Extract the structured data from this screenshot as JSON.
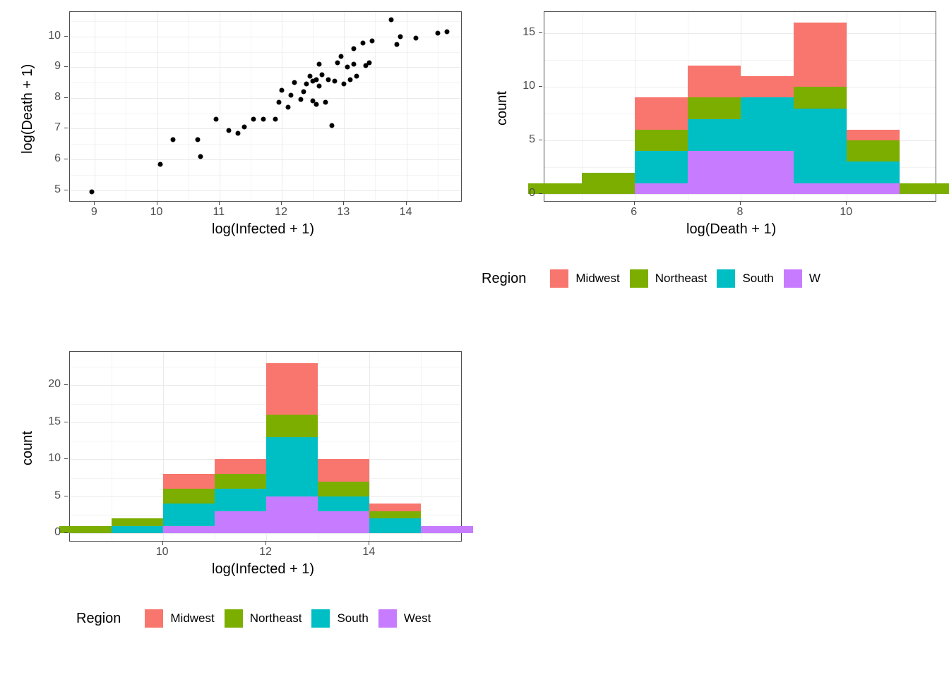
{
  "colors": {
    "Midwest": "#F8766D",
    "Northeast": "#7CAE00",
    "South": "#00BFC4",
    "West": "#C77CFF"
  },
  "legend": {
    "title": "Region",
    "items": [
      "Midwest",
      "Northeast",
      "South",
      "West"
    ],
    "label_midwest": "Midwest",
    "label_northeast": "Northeast",
    "label_south": "South",
    "label_west": "West",
    "label_west_clipped": "W"
  },
  "chart_data": [
    {
      "id": "scatter",
      "type": "scatter",
      "xlabel": "log(Infected + 1)",
      "ylabel": "log(Death + 1)",
      "x_ticks": [
        9,
        10,
        11,
        12,
        13,
        14
      ],
      "y_ticks": [
        5,
        6,
        7,
        8,
        9,
        10
      ],
      "xlim": [
        8.6,
        14.9
      ],
      "ylim": [
        4.6,
        10.8
      ],
      "points": [
        [
          8.95,
          4.95
        ],
        [
          10.05,
          5.85
        ],
        [
          10.25,
          6.65
        ],
        [
          10.65,
          6.65
        ],
        [
          10.7,
          6.1
        ],
        [
          10.95,
          7.3
        ],
        [
          11.15,
          6.95
        ],
        [
          11.3,
          6.85
        ],
        [
          11.4,
          7.05
        ],
        [
          11.55,
          7.3
        ],
        [
          11.7,
          7.3
        ],
        [
          11.9,
          7.3
        ],
        [
          11.95,
          7.85
        ],
        [
          12.0,
          8.25
        ],
        [
          12.1,
          7.7
        ],
        [
          12.15,
          8.1
        ],
        [
          12.2,
          8.5
        ],
        [
          12.3,
          7.95
        ],
        [
          12.35,
          8.2
        ],
        [
          12.4,
          8.45
        ],
        [
          12.45,
          8.7
        ],
        [
          12.5,
          7.9
        ],
        [
          12.5,
          8.55
        ],
        [
          12.55,
          8.6
        ],
        [
          12.55,
          7.8
        ],
        [
          12.6,
          8.4
        ],
        [
          12.6,
          9.1
        ],
        [
          12.65,
          8.75
        ],
        [
          12.7,
          7.85
        ],
        [
          12.75,
          8.6
        ],
        [
          12.8,
          7.1
        ],
        [
          12.85,
          8.55
        ],
        [
          12.9,
          9.15
        ],
        [
          12.95,
          9.35
        ],
        [
          13.0,
          8.45
        ],
        [
          13.05,
          9.0
        ],
        [
          13.1,
          8.6
        ],
        [
          13.15,
          9.1
        ],
        [
          13.15,
          9.6
        ],
        [
          13.2,
          8.7
        ],
        [
          13.3,
          9.8
        ],
        [
          13.35,
          9.05
        ],
        [
          13.4,
          9.15
        ],
        [
          13.45,
          9.85
        ],
        [
          13.75,
          10.55
        ],
        [
          13.85,
          9.75
        ],
        [
          13.9,
          10.0
        ],
        [
          14.15,
          9.95
        ],
        [
          14.5,
          10.1
        ],
        [
          14.65,
          10.15
        ]
      ]
    },
    {
      "id": "hist_death",
      "type": "bar",
      "xlabel": "log(Death + 1)",
      "ylabel": "count",
      "x_ticks": [
        6,
        8,
        10
      ],
      "y_ticks": [
        0,
        5,
        10,
        15
      ],
      "xlim": [
        4.3,
        11.7
      ],
      "ylim": [
        -0.8,
        17.0
      ],
      "bin_width": 1.0,
      "categories": [
        4.5,
        5.5,
        6.5,
        7.5,
        8.5,
        9.5,
        10.5,
        11.5
      ],
      "series": [
        {
          "name": "West",
          "color_key": "West",
          "values": [
            0,
            0,
            1,
            4,
            4,
            1,
            1,
            0
          ]
        },
        {
          "name": "South",
          "color_key": "South",
          "values": [
            0,
            0,
            3,
            3,
            5,
            7,
            2,
            0
          ]
        },
        {
          "name": "Northeast",
          "color_key": "Northeast",
          "values": [
            1,
            2,
            2,
            2,
            0,
            2,
            2,
            1
          ]
        },
        {
          "name": "Midwest",
          "color_key": "Midwest",
          "values": [
            0,
            0,
            3,
            3,
            2,
            6,
            1,
            0
          ]
        }
      ]
    },
    {
      "id": "hist_infected",
      "type": "bar",
      "xlabel": "log(Infected + 1)",
      "ylabel": "count",
      "x_ticks": [
        10,
        12,
        14
      ],
      "y_ticks": [
        0,
        5,
        10,
        15,
        20
      ],
      "xlim": [
        8.2,
        15.8
      ],
      "ylim": [
        -1.2,
        24.5
      ],
      "bin_width": 1.0,
      "categories": [
        8.5,
        9.5,
        10.5,
        11.5,
        12.5,
        13.5,
        14.5,
        15.5
      ],
      "series": [
        {
          "name": "West",
          "color_key": "West",
          "values": [
            0,
            0,
            1,
            3,
            5,
            3,
            0,
            1
          ]
        },
        {
          "name": "South",
          "color_key": "South",
          "values": [
            0,
            1,
            3,
            3,
            8,
            2,
            2,
            0
          ]
        },
        {
          "name": "Northeast",
          "color_key": "Northeast",
          "values": [
            1,
            1,
            2,
            2,
            3,
            2,
            1,
            0
          ]
        },
        {
          "name": "Midwest",
          "color_key": "Midwest",
          "values": [
            0,
            0,
            2,
            2,
            7,
            3,
            1,
            0
          ]
        }
      ]
    }
  ]
}
